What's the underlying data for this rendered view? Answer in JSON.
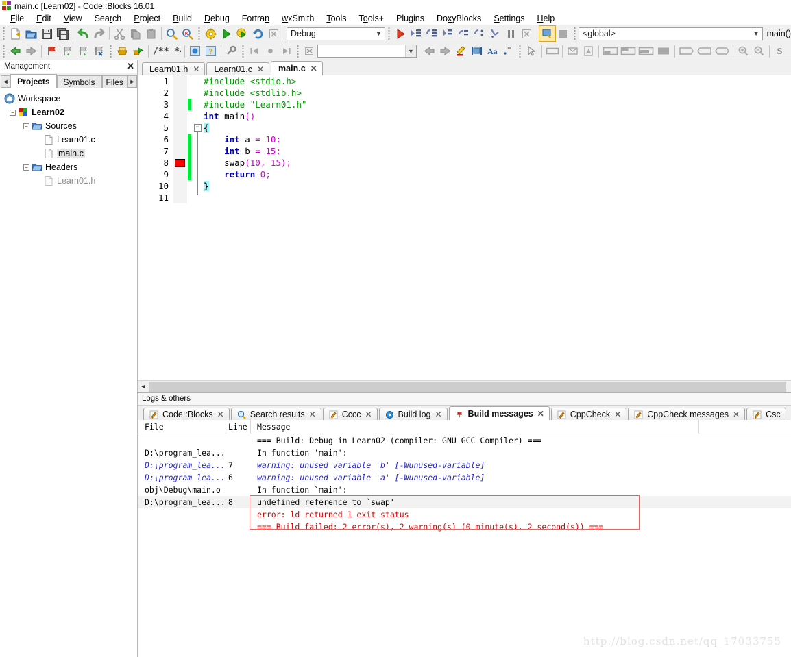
{
  "window": {
    "title": "main.c [Learn02] - Code::Blocks 16.01",
    "logo_icon": "codeblocks-logo-icon"
  },
  "menu": [
    {
      "pre": "F",
      "rest": "ile"
    },
    {
      "pre": "E",
      "rest": "dit"
    },
    {
      "pre": "V",
      "rest": "iew"
    },
    {
      "pre": "Sea",
      "rest": "rch",
      "u": "r"
    },
    {
      "pre": "P",
      "rest": "roject"
    },
    {
      "pre": "B",
      "rest": "uild"
    },
    {
      "pre": "D",
      "rest": "ebug"
    },
    {
      "pre": "Fortran",
      "rest": ""
    },
    {
      "pre": "w",
      "rest": "xSmith"
    },
    {
      "pre": "T",
      "rest": "ools"
    },
    {
      "pre": "T",
      "rest": "ools+"
    },
    {
      "pre": "P",
      "rest": "lugins"
    },
    {
      "pre": "D",
      "rest": "oxyBlocks"
    },
    {
      "pre": "S",
      "rest": "ettings"
    },
    {
      "pre": "H",
      "rest": "elp"
    }
  ],
  "menu_labels": [
    "File",
    "Edit",
    "View",
    "Search",
    "Project",
    "Build",
    "Debug",
    "Fortran",
    "wxSmith",
    "Tools",
    "Tools+",
    "Plugins",
    "DoxyBlocks",
    "Settings",
    "Help"
  ],
  "toolbar1": {
    "icons": [
      "new-file-icon",
      "open-file-icon",
      "save-icon",
      "save-all-icon",
      "undo-icon",
      "redo-icon",
      "cut-icon",
      "copy-icon",
      "paste-icon",
      "find-icon",
      "replace-icon",
      "build-icon",
      "run-icon",
      "build-and-run-icon",
      "rebuild-icon",
      "abort-build-icon"
    ],
    "target_value": "Debug",
    "debug_icons": [
      "debug-continue-icon",
      "debug-run-to-cursor-icon",
      "debug-next-line-icon",
      "debug-step-into-icon",
      "debug-step-out-icon",
      "debug-next-instruction-icon",
      "debug-step-into-instruction-icon",
      "debug-break-icon",
      "debug-stop-icon",
      "debugging-windows-icon",
      "various-info-icon"
    ],
    "scope_value": "<global>",
    "function_value": "main()"
  },
  "toolbar2": {
    "icons": [
      "back-icon",
      "forward-icon",
      "toggle-bookmark-icon",
      "prev-bookmark-icon",
      "next-bookmark-icon",
      "clear-bookmarks-icon",
      "doxyblocks-run-icon",
      "doxyblocks-extract-icon",
      "doxyblocks-comment-icon",
      "doxyblocks-wizard-icon",
      "doxyblocks-help-icon",
      "doxyblocks-config-icon",
      "prev-changed-line-icon",
      "current-line-icon",
      "next-changed-line-icon",
      "clear-search-icon",
      "find-prev-icon",
      "find-next-icon",
      "highlight-icon",
      "selected-text-icon",
      "match-case-icon",
      "regex-icon",
      "pointer-icon",
      "panel-icon",
      "wxsmith-icon-1",
      "wxsmith-icon-2",
      "layout-top-icon",
      "layout-bottom-icon",
      "layout-fill-icon",
      "layout-full-icon",
      "expand-right-icon",
      "expand-left-icon",
      "expand-both-icon",
      "zoom-in-icon",
      "zoom-out-icon",
      "smith-s-icon"
    ],
    "search_value": "",
    "search_placeholder": ""
  },
  "management": {
    "title": "Management",
    "close_icon": "close-icon",
    "scroll_left_icon": "chevron-left-icon",
    "scroll_right_icon": "chevron-right-icon",
    "tabs": [
      {
        "label": "Projects",
        "active": true
      },
      {
        "label": "Symbols",
        "active": false
      },
      {
        "label": "Files",
        "active": false
      }
    ],
    "tree": [
      {
        "label": "Workspace",
        "icon": "workspace-icon",
        "depth": 0,
        "bold": false,
        "expander": "",
        "selected": false,
        "dim": false
      },
      {
        "label": "Learn02",
        "icon": "project-icon",
        "depth": 1,
        "bold": true,
        "expander": "-",
        "selected": false,
        "dim": false
      },
      {
        "label": "Sources",
        "icon": "folder-icon",
        "depth": 2,
        "bold": false,
        "expander": "-",
        "selected": false,
        "dim": false
      },
      {
        "label": "Learn01.c",
        "icon": "file-icon",
        "depth": 3,
        "bold": false,
        "expander": "",
        "selected": false,
        "dim": false
      },
      {
        "label": "main.c",
        "icon": "file-icon",
        "depth": 3,
        "bold": false,
        "expander": "",
        "selected": true,
        "dim": false
      },
      {
        "label": "Headers",
        "icon": "folder-icon",
        "depth": 2,
        "bold": false,
        "expander": "-",
        "selected": false,
        "dim": false
      },
      {
        "label": "Learn01.h",
        "icon": "file-icon",
        "depth": 3,
        "bold": false,
        "expander": "",
        "selected": false,
        "dim": true
      }
    ]
  },
  "editor": {
    "tabs": [
      {
        "label": "Learn01.h",
        "active": false,
        "close_icon": "close-icon"
      },
      {
        "label": "Learn01.c",
        "active": false,
        "close_icon": "close-icon"
      },
      {
        "label": "main.c",
        "active": true,
        "close_icon": "close-icon"
      }
    ],
    "line_numbers": [
      "1",
      "2",
      "3",
      "4",
      "5",
      "6",
      "7",
      "8",
      "9",
      "10",
      "11"
    ],
    "code_lines": [
      {
        "n": 1,
        "text": "#include <stdio.h>"
      },
      {
        "n": 2,
        "text": "#include <stdlib.h>"
      },
      {
        "n": 3,
        "text": "#include \"Learn01.h\""
      },
      {
        "n": 4,
        "text": "int main()"
      },
      {
        "n": 5,
        "text": "{"
      },
      {
        "n": 6,
        "text": "    int a = 10;"
      },
      {
        "n": 7,
        "text": "    int b = 15;"
      },
      {
        "n": 8,
        "text": "    swap(10, 15);"
      },
      {
        "n": 9,
        "text": "    return 0;"
      },
      {
        "n": 10,
        "text": "}"
      },
      {
        "n": 11,
        "text": ""
      }
    ],
    "breakpoint_line": 8,
    "fold_line": 5,
    "scroll_left_icon": "chevron-left-icon"
  },
  "logs": {
    "title": "Logs & others",
    "tabs": [
      {
        "label": "Code::Blocks",
        "icon": "pencil-icon",
        "active": false,
        "close_icon": "close-icon"
      },
      {
        "label": "Search results",
        "icon": "search-icon",
        "active": false,
        "close_icon": "close-icon"
      },
      {
        "label": "Cccc",
        "icon": "pencil-icon",
        "active": false,
        "close_icon": "close-icon"
      },
      {
        "label": "Build log",
        "icon": "gear-icon",
        "active": false,
        "close_icon": "close-icon"
      },
      {
        "label": "Build messages",
        "icon": "pin-icon",
        "active": true,
        "close_icon": "close-icon"
      },
      {
        "label": "CppCheck",
        "icon": "pencil-icon",
        "active": false,
        "close_icon": "close-icon"
      },
      {
        "label": "CppCheck messages",
        "icon": "pencil-icon",
        "active": false,
        "close_icon": "close-icon"
      },
      {
        "label": "Csc",
        "icon": "pencil-icon",
        "active": false,
        "close_icon": "close-icon"
      }
    ],
    "columns": [
      "File",
      "Line",
      "Message"
    ],
    "rows": [
      {
        "file": "",
        "line": "",
        "message": "=== Build: Debug in Learn02 (compiler: GNU GCC Compiler) ===",
        "style": "normal",
        "shade": false
      },
      {
        "file": "D:\\program_lea...",
        "line": "",
        "message": "In function 'main':",
        "style": "normal",
        "shade": false
      },
      {
        "file": "D:\\program_lea...",
        "line": "7",
        "message": "warning: unused variable 'b' [-Wunused-variable]",
        "style": "blue",
        "shade": false
      },
      {
        "file": "D:\\program_lea...",
        "line": "6",
        "message": "warning: unused variable 'a' [-Wunused-variable]",
        "style": "blue",
        "shade": false
      },
      {
        "file": "obj\\Debug\\main.o",
        "line": "",
        "message": "In function `main':",
        "style": "normal",
        "shade": false
      },
      {
        "file": "D:\\program_lea...",
        "line": "8",
        "message": "undefined reference to `swap'",
        "style": "normal",
        "shade": true
      },
      {
        "file": "",
        "line": "",
        "message": "error: ld returned 1 exit status",
        "style": "red",
        "shade": false
      },
      {
        "file": "",
        "line": "",
        "message": "=== Build failed: 2 error(s), 2 warning(s) (0 minute(s), 2 second(s)) ===",
        "style": "red",
        "shade": false
      }
    ]
  },
  "watermark": "http://blog.csdn.net/qq_17033755",
  "colors": {
    "error_box": "#e06666",
    "breakpoint": "#ff0000",
    "changed_line": "#00e83c",
    "keyword": "#0000c0",
    "preprocessor": "#009900",
    "number": "#cc00cc",
    "warning_text": "#2222cc",
    "error_text": "#dd0000"
  }
}
